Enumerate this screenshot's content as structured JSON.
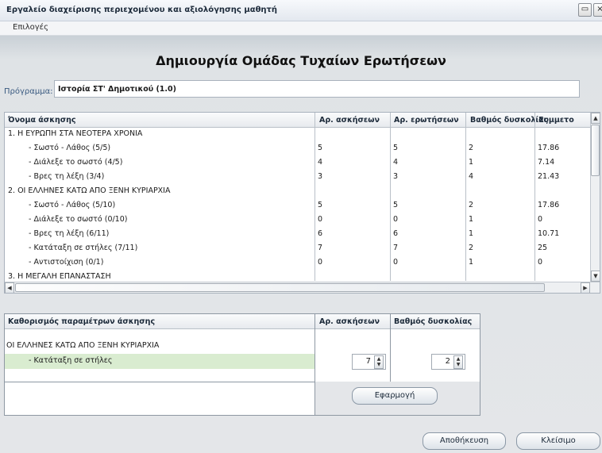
{
  "window": {
    "title": "Εργαλείο διαχείρισης περιεχομένου και αξιολόγησης μαθητή",
    "maximize_glyph": "▭",
    "close_glyph": "×"
  },
  "menu": {
    "options_label": "Επιλογές"
  },
  "page": {
    "heading": "Δημιουργία Ομάδας Τυχαίων Ερωτήσεων"
  },
  "program": {
    "label": "Πρόγραμμα:",
    "value": "Ιστορία ΣΤ' Δημοτικού (1.0)"
  },
  "exercise_table": {
    "columns": [
      "Όνομα άσκησης",
      "Αρ. ασκήσεων",
      "Αρ. ερωτήσεων",
      "Βαθμός δυσκολίας",
      "Συμμετο"
    ],
    "rows": [
      {
        "name": "1.  Η ΕΥΡΩΠΗ ΣΤΑ ΝΕΟΤΕΡΑ ΧΡΟΝΙΑ",
        "exercises": "",
        "questions": "",
        "difficulty": "",
        "share": ""
      },
      {
        "name": "- Σωστό - Λάθος  (5/5)",
        "exercises": "5",
        "questions": "5",
        "difficulty": "2",
        "share": "17.86"
      },
      {
        "name": "- Διάλεξε το σωστό  (4/5)",
        "exercises": "4",
        "questions": "4",
        "difficulty": "1",
        "share": "7.14"
      },
      {
        "name": "- Βρες τη λέξη  (3/4)",
        "exercises": "3",
        "questions": "3",
        "difficulty": "4",
        "share": "21.43"
      },
      {
        "name": "2.  ΟΙ ΕΛΛΗΝΕΣ ΚΑΤΩ ΑΠΟ ΞΕΝΗ ΚΥΡΙΑΡΧΙΑ",
        "exercises": "",
        "questions": "",
        "difficulty": "",
        "share": ""
      },
      {
        "name": "- Σωστό - Λάθος  (5/10)",
        "exercises": "5",
        "questions": "5",
        "difficulty": "2",
        "share": "17.86"
      },
      {
        "name": "- Διάλεξε το σωστό  (0/10)",
        "exercises": "0",
        "questions": "0",
        "difficulty": "1",
        "share": "0"
      },
      {
        "name": "- Βρες τη λέξη  (6/11)",
        "exercises": "6",
        "questions": "6",
        "difficulty": "1",
        "share": "10.71"
      },
      {
        "name": "- Κατάταξη σε στήλες  (7/11)",
        "exercises": "7",
        "questions": "7",
        "difficulty": "2",
        "share": "25"
      },
      {
        "name": "- Αντιστοίχιση  (0/1)",
        "exercises": "0",
        "questions": "0",
        "difficulty": "1",
        "share": "0"
      },
      {
        "name": "3.  Η ΜΕΓΑΛΗ ΕΠΑΝΑΣΤΑΣΗ",
        "exercises": "",
        "questions": "",
        "difficulty": "",
        "share": ""
      }
    ]
  },
  "params": {
    "columns": [
      "Καθορισμός παραμέτρων άσκησης",
      "Αρ. ασκήσεων",
      "Βαθμός δυσκολίας"
    ],
    "section": "ΟΙ ΕΛΛΗΝΕΣ ΚΑΤΩ ΑΠΟ ΞΕΝΗ ΚΥΡΙΑΡΧΙΑ",
    "selected_exercise": "- Κατάταξη σε στήλες",
    "exercises_value": "7",
    "difficulty_value": "2",
    "apply_label": "Εφαρμογή"
  },
  "buttons": {
    "save_label": "Αποθήκευση",
    "close_label": "Κλείσιμο"
  }
}
